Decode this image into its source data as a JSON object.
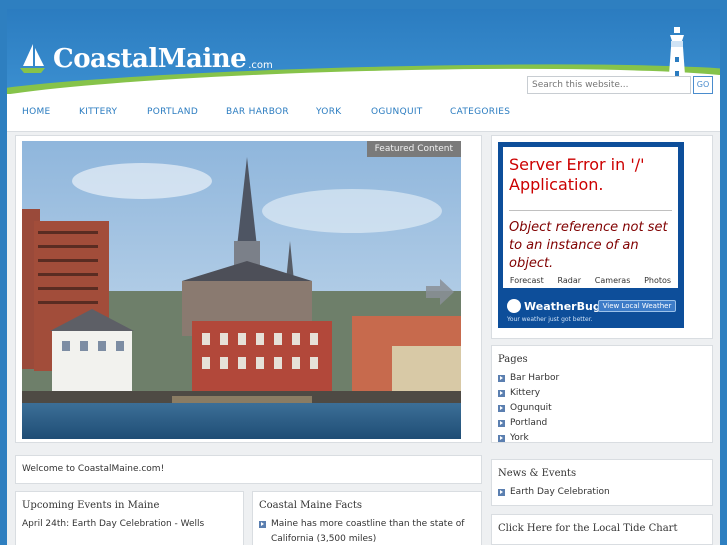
{
  "site": {
    "name": "CoastalMaine",
    "domain_suffix": ".com"
  },
  "search": {
    "placeholder": "Search this website...",
    "button_label": "GO"
  },
  "nav": {
    "items": [
      "HOME",
      "KITTERY",
      "PORTLAND",
      "BAR HARBOR",
      "YORK",
      "OGUNQUIT",
      "CATEGORIES"
    ]
  },
  "featured": {
    "label": "Featured Content"
  },
  "weather": {
    "error_title": "Server Error in '/' Application.",
    "error_message": "Object reference not set to an instance of an object.",
    "tabs": [
      "Forecast",
      "Radar",
      "Cameras",
      "Photos"
    ],
    "brand": "WeatherBug",
    "button_label": "View Local Weather",
    "tagline": "Your weather just got better."
  },
  "pages": {
    "title": "Pages",
    "items": [
      "Bar Harbor",
      "Kittery",
      "Ogunquit",
      "Portland",
      "York"
    ]
  },
  "news": {
    "title": "News & Events",
    "items": [
      "Earth Day Celebration"
    ]
  },
  "tide": {
    "title": "Click Here for the Local Tide Chart"
  },
  "welcome": {
    "text": "Welcome to CoastalMaine.com!"
  },
  "events": {
    "title": "Upcoming Events in Maine",
    "items": [
      "April 24th: Earth Day Celebration - Wells"
    ]
  },
  "facts": {
    "title": "Coastal Maine Facts",
    "items": [
      "Maine has more coastline than the state of California (3,500 miles)"
    ]
  },
  "colors": {
    "header_blue": "#2b7cc0",
    "nav_link": "#2b7cc0",
    "accent_green": "#86c34a",
    "error_red": "#cc0000"
  }
}
